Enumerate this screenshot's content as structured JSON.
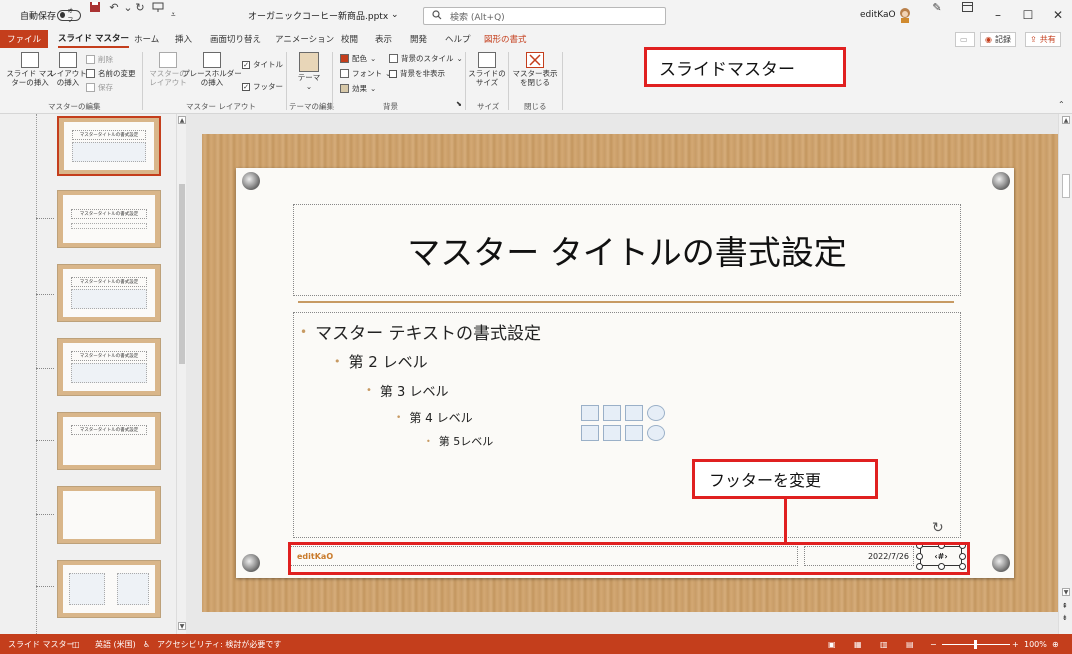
{
  "titlebar": {
    "autosave_label": "自動保存",
    "autosave_state": "オフ",
    "filename": "オーガニックコーヒー新商品.pptx",
    "search_placeholder": "検索 (Alt+Q)",
    "username": "editKaO"
  },
  "tabs": [
    "ファイル",
    "スライド マスター",
    "ホーム",
    "挿入",
    "画面切り替え",
    "アニメーション",
    "校閲",
    "表示",
    "開発",
    "ヘルプ",
    "図形の書式"
  ],
  "tab_buttons": {
    "record": "記録",
    "share": "共有"
  },
  "ribbon": {
    "insert_master": "スライド マス\nターの挿入",
    "insert_layout": "レイアウト\nの挿入",
    "delete": "削除",
    "rename": "名前の変更",
    "preserve": "保存",
    "group_master_edit": "マスターの編集",
    "master_layout": "マスターの\nレイアウト",
    "insert_placeholder": "プレースホルダー\nの挿入",
    "title_check": "タイトル",
    "footer_check": "フッター",
    "group_master_layout": "マスター レイアウト",
    "theme": "テーマ",
    "group_theme_edit": "テーマの編集",
    "colors": "配色",
    "fonts": "フォント",
    "effects": "効果",
    "bg_styles": "背景のスタイル",
    "hide_bg": "背景を非表示",
    "group_background": "背景",
    "slide_size": "スライドの\nサイズ",
    "group_size": "サイズ",
    "close_master": "マスター表示\nを閉じる",
    "group_close": "閉じる"
  },
  "callouts": {
    "top": "スライドマスター",
    "footer": "フッターを変更"
  },
  "thumbnails": {
    "title_text": "マスタータイトルの書式設定"
  },
  "slide": {
    "title": "マスター タイトルの書式設定",
    "levels": [
      "マスター テキストの書式設定",
      "第 2 レベル",
      "第 3 レベル",
      "第 4 レベル",
      "第 5レベル"
    ],
    "footer_text": "editKaO",
    "date": "2022/7/26",
    "page_number": "‹#›"
  },
  "statusbar": {
    "view": "スライド マスター",
    "language": "英語 (米国)",
    "accessibility": "アクセシビリティ: 検討が必要です",
    "zoom": "100%"
  },
  "colors": {
    "accent": "#c43e1c",
    "callout_border": "#e02020",
    "wood": "#c99e6a",
    "footer_text": "#c97a2a"
  }
}
